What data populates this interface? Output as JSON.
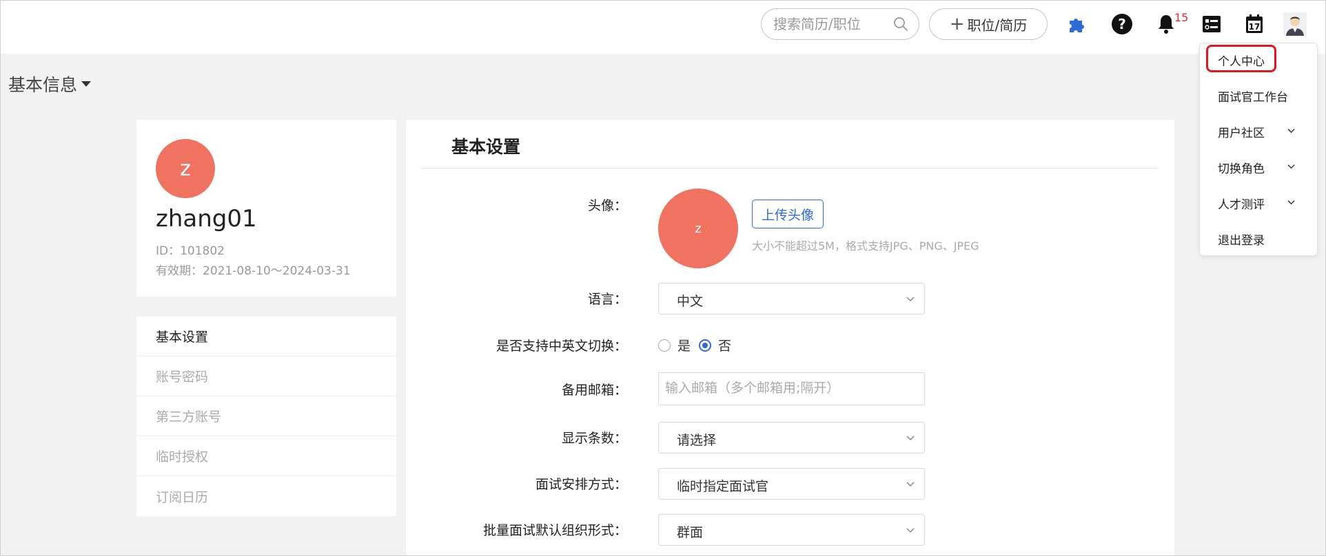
{
  "header": {
    "search_placeholder": "搜索简历/职位",
    "add_button_label": "职位/简历",
    "notification_count": "15",
    "icons": [
      "plugin-icon",
      "help-icon",
      "bell-icon",
      "todo-icon",
      "calendar-icon",
      "user-avatar-icon"
    ],
    "calendar_day": "17"
  },
  "page": {
    "title": "基本信息"
  },
  "profile": {
    "avatar_letter": "z",
    "username": "zhang01",
    "id_line": "ID：101802",
    "validity_line": "有效期：2021-08-10～2024-03-31"
  },
  "sidenav": {
    "items": [
      "基本设置",
      "账号密码",
      "第三方账号",
      "临时授权",
      "订阅日历"
    ]
  },
  "main": {
    "title": "基本设置",
    "avatar": {
      "label": "头像：",
      "letter": "z",
      "upload_button": "上传头像",
      "hint": "大小不能超过5M，格式支持JPG、PNG、JPEG"
    },
    "language": {
      "label": "语言：",
      "value": "中文"
    },
    "bilingual": {
      "label": "是否支持中英文切换：",
      "yes": "是",
      "no": "否",
      "selected": "否"
    },
    "backup_email": {
      "label": "备用邮箱：",
      "placeholder": "输入邮箱（多个邮箱用;隔开）"
    },
    "page_size": {
      "label": "显示条数：",
      "value": "请选择"
    },
    "interview_arrange": {
      "label": "面试安排方式：",
      "value": "临时指定面试官"
    },
    "batch_interview": {
      "label": "批量面试默认组织形式：",
      "value": "群面"
    }
  },
  "user_menu": {
    "items": [
      "个人中心",
      "面试官工作台",
      "用户社区",
      "切换角色",
      "人才测评",
      "退出登录"
    ],
    "highlighted": "个人中心"
  },
  "colors": {
    "accent": "#2f6bd8",
    "avatar_bg": "#f07260",
    "highlight_border": "#e8141b",
    "badge": "#e03030"
  }
}
